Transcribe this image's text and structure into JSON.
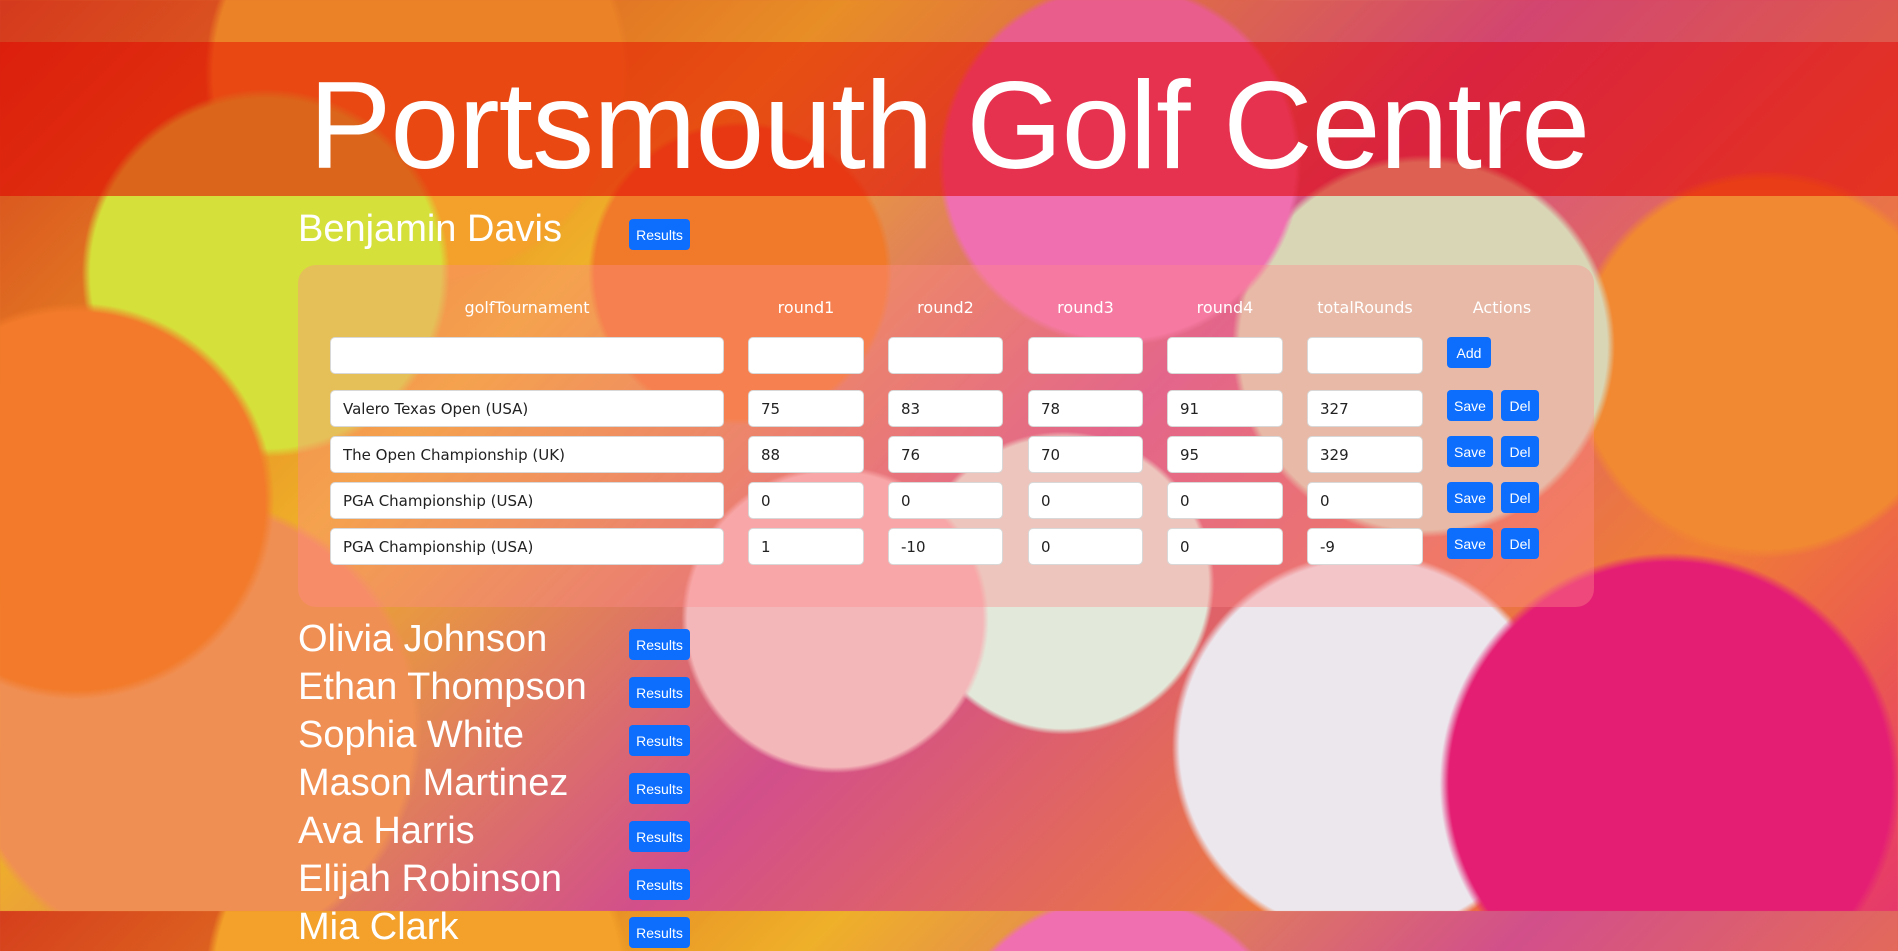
{
  "site": {
    "title": "Portsmouth Golf Centre"
  },
  "results_label": "Results",
  "players": [
    {
      "name": "Benjamin Davis",
      "expanded": true
    },
    {
      "name": "Olivia Johnson"
    },
    {
      "name": "Ethan Thompson"
    },
    {
      "name": "Sophia White"
    },
    {
      "name": "Mason Martinez"
    },
    {
      "name": "Ava Harris"
    },
    {
      "name": "Elijah Robinson"
    },
    {
      "name": "Mia Clark"
    }
  ],
  "table": {
    "headers": [
      "golfTournament",
      "round1",
      "round2",
      "round3",
      "round4",
      "totalRounds",
      "Actions"
    ],
    "new_row": [
      "",
      "",
      "",
      "",
      "",
      ""
    ],
    "add_label": "Add",
    "save_label": "Save",
    "del_label": "Del",
    "rows": [
      [
        "Valero Texas Open (USA)",
        "75",
        "83",
        "78",
        "91",
        "327"
      ],
      [
        "The Open Championship (UK)",
        "88",
        "76",
        "70",
        "95",
        "329"
      ],
      [
        "PGA Championship (USA)",
        "0",
        "0",
        "0",
        "0",
        "0"
      ],
      [
        "PGA Championship (USA)",
        "1",
        "-10",
        "0",
        "0",
        "-9"
      ]
    ]
  }
}
